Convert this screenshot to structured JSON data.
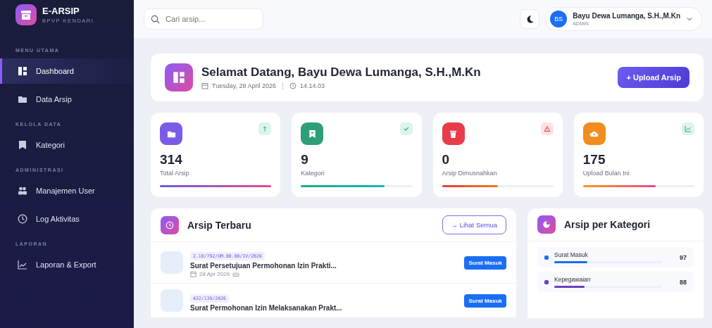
{
  "brand": {
    "title": "E-ARSIP",
    "subtitle": "BPVP KENDARI"
  },
  "sidebar": {
    "sections": [
      {
        "heading": "MENU UTAMA",
        "items": [
          {
            "label": "Dashboard",
            "selected": true
          },
          {
            "label": "Data Arsip",
            "selected": false
          }
        ]
      },
      {
        "heading": "KELOLA DATA",
        "items": [
          {
            "label": "Kategori",
            "selected": false
          }
        ]
      },
      {
        "heading": "ADMINISTRASI",
        "items": [
          {
            "label": "Manajemen User",
            "selected": false
          },
          {
            "label": "Log Aktivitas",
            "selected": false
          }
        ]
      },
      {
        "heading": "LAPORAN",
        "items": [
          {
            "label": "Laporan & Export",
            "selected": false
          }
        ]
      }
    ]
  },
  "search": {
    "placeholder": "Cari arsip..."
  },
  "user": {
    "initials": "BS",
    "name": "Bayu Dewa Lumanga, S.H.,M.Kn",
    "role": "ADMIN"
  },
  "welcome": {
    "title": "Selamat Datang, Bayu Dewa Lumanga, S.H.,M.Kn",
    "date": "Tuesday, 28 April 2026",
    "time": "14.14.03",
    "button": "+ Upload Arsip"
  },
  "stats": [
    {
      "value": "314",
      "label": "Total Arsip",
      "level": 1.0,
      "color": "#7b5be6"
    },
    {
      "value": "9",
      "label": "Kategori",
      "level": 0.75,
      "color": "#2e9e78"
    },
    {
      "value": "0",
      "label": "Arsip Dimusnahkan",
      "level": 0.5,
      "color": "#ea3b4b"
    },
    {
      "value": "175",
      "label": "Upload Bulan Ini",
      "level": 0.65,
      "color": "#f28c1c"
    }
  ],
  "recent": {
    "title": "Arsip Terbaru",
    "button": "→ Lihat Semua",
    "items": [
      {
        "number": "2.18/792/UM.00.00/IV/2026",
        "title": "Surat Persetujuan Permohonan Izin Prakti...",
        "date": "28 Apr 2026",
        "badge": "Surat Masuk"
      },
      {
        "number": "422/139/2026",
        "title": "Surat Permohonan Izin Melaksanakan Prakt...",
        "badge": "Surat Masuk"
      }
    ]
  },
  "categories": {
    "title": "Arsip per Kategori",
    "items": [
      {
        "name": "Surat Masuk",
        "count": "97",
        "level": 0.31,
        "color": "#1a6ef5"
      },
      {
        "name": "Kepegawaian",
        "count": "88",
        "level": 0.28,
        "color": "#6a3fc2"
      }
    ]
  }
}
